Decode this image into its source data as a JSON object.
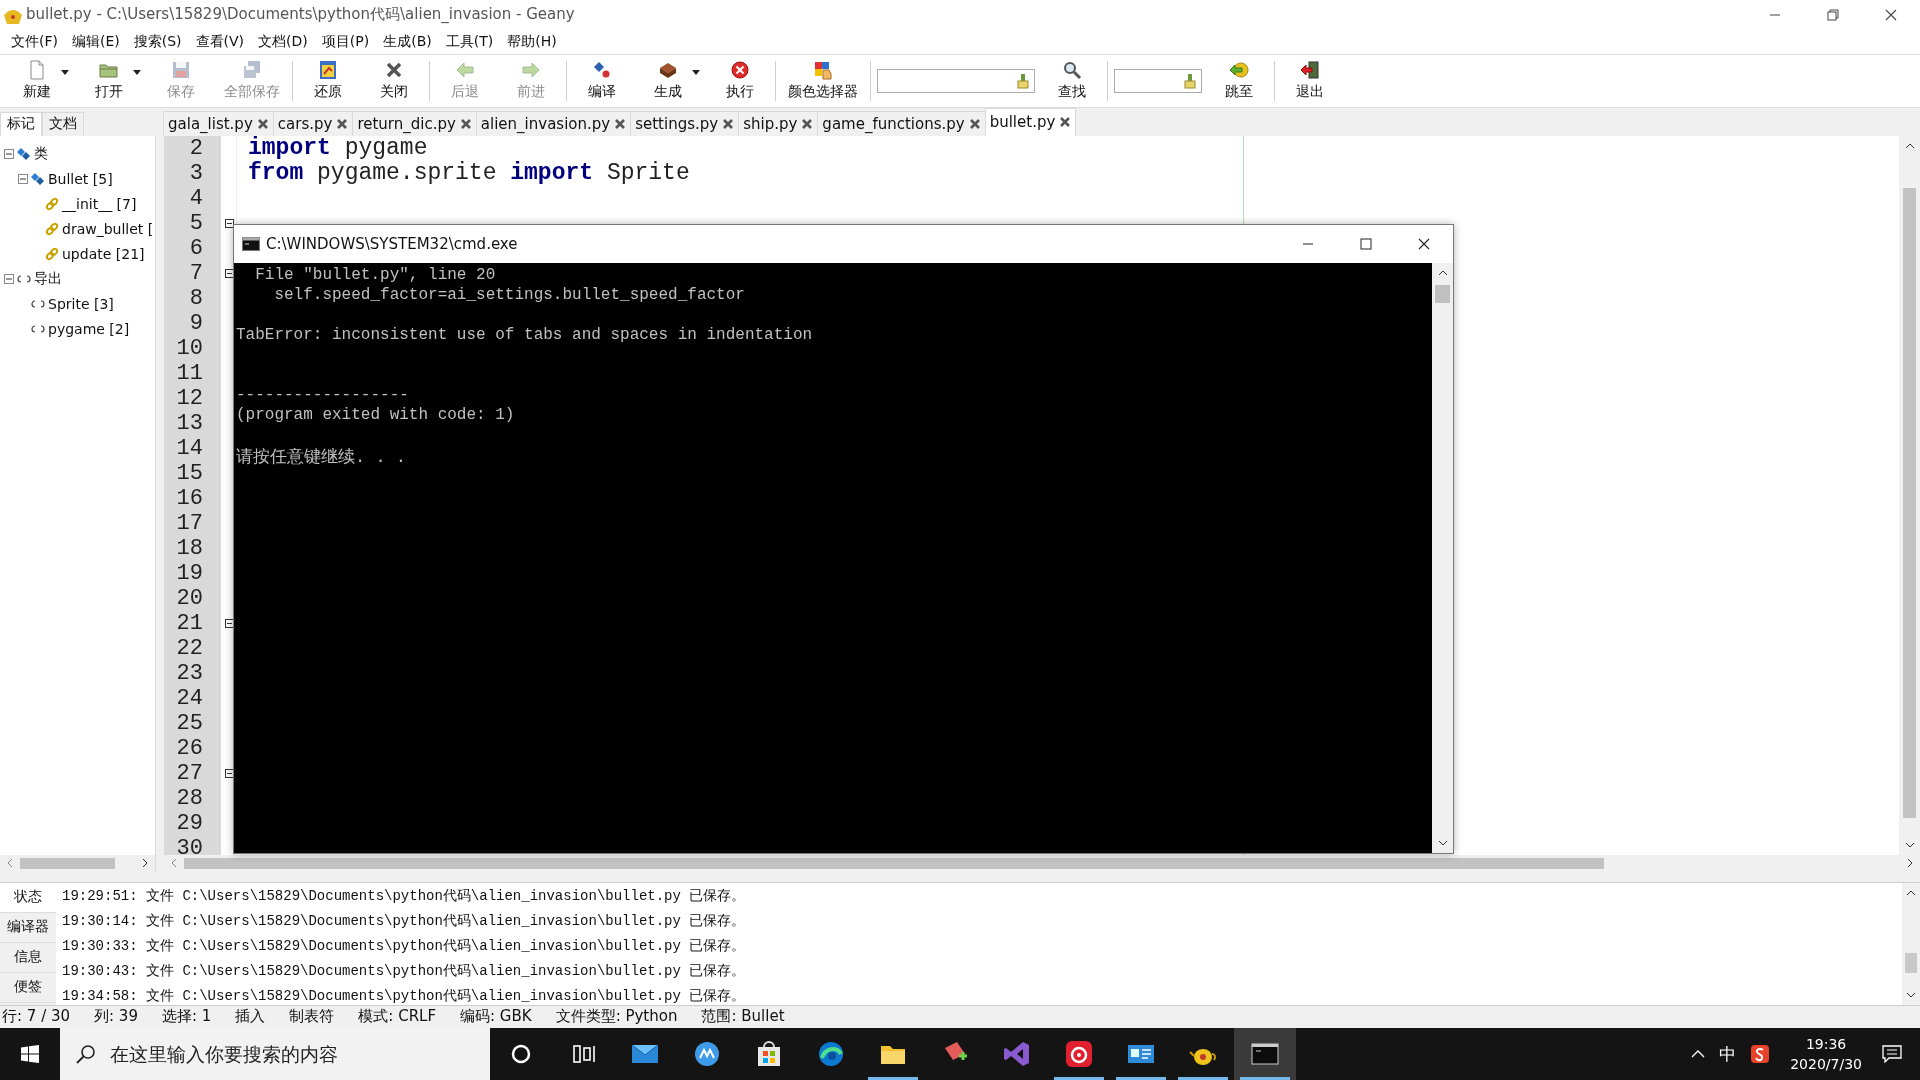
{
  "window": {
    "title": "bullet.py - C:\\Users\\15829\\Documents\\python代码\\alien_invasion - Geany"
  },
  "menu": [
    "文件(F)",
    "编辑(E)",
    "搜索(S)",
    "查看(V)",
    "文档(D)",
    "项目(P)",
    "生成(B)",
    "工具(T)",
    "帮助(H)"
  ],
  "toolbar": {
    "groups": [
      [
        {
          "kind": "button",
          "label": "新建",
          "disabled": false,
          "dropdown": true
        },
        {
          "kind": "button",
          "label": "打开",
          "disabled": false,
          "dropdown": true
        },
        {
          "kind": "button",
          "label": "保存",
          "disabled": true,
          "dropdown": false
        },
        {
          "kind": "button",
          "label": "全部保存",
          "disabled": true,
          "dropdown": false
        }
      ],
      [
        {
          "kind": "button",
          "label": "还原",
          "disabled": false,
          "dropdown": false
        },
        {
          "kind": "button",
          "label": "关闭",
          "disabled": false,
          "dropdown": false
        }
      ],
      [
        {
          "kind": "button",
          "label": "后退",
          "disabled": true,
          "dropdown": false
        },
        {
          "kind": "button",
          "label": "前进",
          "disabled": true,
          "dropdown": false
        }
      ],
      [
        {
          "kind": "button",
          "label": "编译",
          "disabled": false,
          "dropdown": false
        },
        {
          "kind": "button",
          "label": "生成",
          "disabled": false,
          "dropdown": true
        },
        {
          "kind": "button",
          "label": "执行",
          "disabled": false,
          "dropdown": false
        }
      ],
      [
        {
          "kind": "button",
          "label": "颜色选择器",
          "disabled": false,
          "dropdown": false
        }
      ],
      [
        {
          "kind": "field"
        },
        {
          "kind": "button",
          "label": "查找",
          "disabled": false,
          "dropdown": false
        }
      ],
      [
        {
          "kind": "field"
        },
        {
          "kind": "button",
          "label": "跳至",
          "disabled": false,
          "dropdown": false
        }
      ],
      [
        {
          "kind": "button",
          "label": "退出",
          "disabled": false,
          "dropdown": false
        }
      ]
    ]
  },
  "sidebar": {
    "tabs": [
      {
        "label": "标记",
        "selected": true
      },
      {
        "label": "文档",
        "selected": false
      }
    ],
    "tree": [
      {
        "label": "类",
        "kind": "class",
        "expanded": true,
        "children": [
          {
            "label": "Bullet [5]",
            "kind": "class",
            "expanded": true,
            "children": [
              {
                "label": "__init__ [7]",
                "kind": "method"
              },
              {
                "label": "draw_bullet [",
                "kind": "method"
              },
              {
                "label": "update [21]",
                "kind": "method"
              }
            ]
          }
        ]
      },
      {
        "label": "导出",
        "kind": "import",
        "expanded": true,
        "children": [
          {
            "label": "Sprite [3]",
            "kind": "import"
          },
          {
            "label": "pygame [2]",
            "kind": "import"
          }
        ]
      }
    ]
  },
  "tabs": [
    {
      "label": "gala_list.py",
      "selected": false
    },
    {
      "label": "cars.py",
      "selected": false
    },
    {
      "label": "return_dic.py",
      "selected": false
    },
    {
      "label": "alien_invasion.py",
      "selected": false
    },
    {
      "label": "settings.py",
      "selected": false
    },
    {
      "label": "ship.py",
      "selected": false
    },
    {
      "label": "game_functions.py",
      "selected": false
    },
    {
      "label": "bullet.py",
      "selected": true
    }
  ],
  "editor": {
    "lines": [
      {
        "number": "2",
        "text": "**import** pygame",
        "fold": false
      },
      {
        "number": "3",
        "text": "**from** pygame.sprite **import** Sprite",
        "fold": false
      },
      {
        "number": "4",
        "fold": false
      },
      {
        "number": "5",
        "fold": true
      },
      {
        "number": "6",
        "fold": false
      },
      {
        "number": "7",
        "fold": true
      },
      {
        "number": "8",
        "fold": false
      },
      {
        "number": "9",
        "fold": false
      },
      {
        "number": "10",
        "fold": false
      },
      {
        "number": "11",
        "fold": false
      },
      {
        "number": "12",
        "fold": false
      },
      {
        "number": "13",
        "fold": false
      },
      {
        "number": "14",
        "fold": false
      },
      {
        "number": "15",
        "fold": false
      },
      {
        "number": "16",
        "fold": false
      },
      {
        "number": "17",
        "fold": false
      },
      {
        "number": "18",
        "fold": false
      },
      {
        "number": "19",
        "fold": false
      },
      {
        "number": "20",
        "fold": false
      },
      {
        "number": "21",
        "fold": true
      },
      {
        "number": "22",
        "fold": false
      },
      {
        "number": "23",
        "fold": false
      },
      {
        "number": "24",
        "fold": false
      },
      {
        "number": "25",
        "fold": false
      },
      {
        "number": "26",
        "fold": false
      },
      {
        "number": "27",
        "fold": true
      },
      {
        "number": "28",
        "fold": false
      },
      {
        "number": "29",
        "fold": false
      },
      {
        "number": "30",
        "fold": false
      }
    ]
  },
  "console": {
    "title": "C:\\WINDOWS\\SYSTEM32\\cmd.exe",
    "blocks": [
      [
        "  File \"bullet.py\", line 20",
        "    self.speed_factor=ai_settings.bullet_speed_factor"
      ],
      [
        "TabError: inconsistent use of tabs and spaces in indentation"
      ],
      [
        "------------------",
        "(program exited with code: 1)"
      ],
      [
        "请按任意键继续. . ."
      ]
    ]
  },
  "messages": {
    "tabs": [
      {
        "label": "状态",
        "selected": true
      },
      {
        "label": "编译器",
        "selected": false
      },
      {
        "label": "信息",
        "selected": false
      },
      {
        "label": "便签",
        "selected": false
      }
    ],
    "lines": [
      "19:29:51: 文件 C:\\Users\\15829\\Documents\\python代码\\alien_invasion\\bullet.py 已保存。",
      "19:30:14: 文件 C:\\Users\\15829\\Documents\\python代码\\alien_invasion\\bullet.py 已保存。",
      "19:30:33: 文件 C:\\Users\\15829\\Documents\\python代码\\alien_invasion\\bullet.py 已保存。",
      "19:30:43: 文件 C:\\Users\\15829\\Documents\\python代码\\alien_invasion\\bullet.py 已保存。",
      "19:34:58: 文件 C:\\Users\\15829\\Documents\\python代码\\alien_invasion\\bullet.py 已保存。"
    ]
  },
  "status_bar": [
    "行: 7 / 30",
    "列: 39",
    "选择: 1",
    "插入",
    "制表符",
    "模式: CRLF",
    "编码: GBK",
    "文件类型: Python",
    "范围: Bullet"
  ],
  "taskbar": {
    "search": {
      "placeholder": "在这里输入你要搜索的内容"
    },
    "apps": [
      {
        "open": false,
        "selected": false
      },
      {
        "open": false,
        "selected": false
      },
      {
        "open": false,
        "selected": false
      },
      {
        "open": false,
        "selected": false
      },
      {
        "open": false,
        "selected": false
      },
      {
        "open": false,
        "selected": false
      },
      {
        "open": true,
        "selected": false
      },
      {
        "open": false,
        "selected": false
      },
      {
        "open": false,
        "selected": false
      },
      {
        "open": true,
        "selected": false
      },
      {
        "open": true,
        "selected": false
      },
      {
        "open": true,
        "selected": false
      },
      {
        "open": true,
        "selected": true
      }
    ],
    "tray": {
      "ime": "中",
      "time": "19:36",
      "date": "2020/7/30"
    }
  }
}
